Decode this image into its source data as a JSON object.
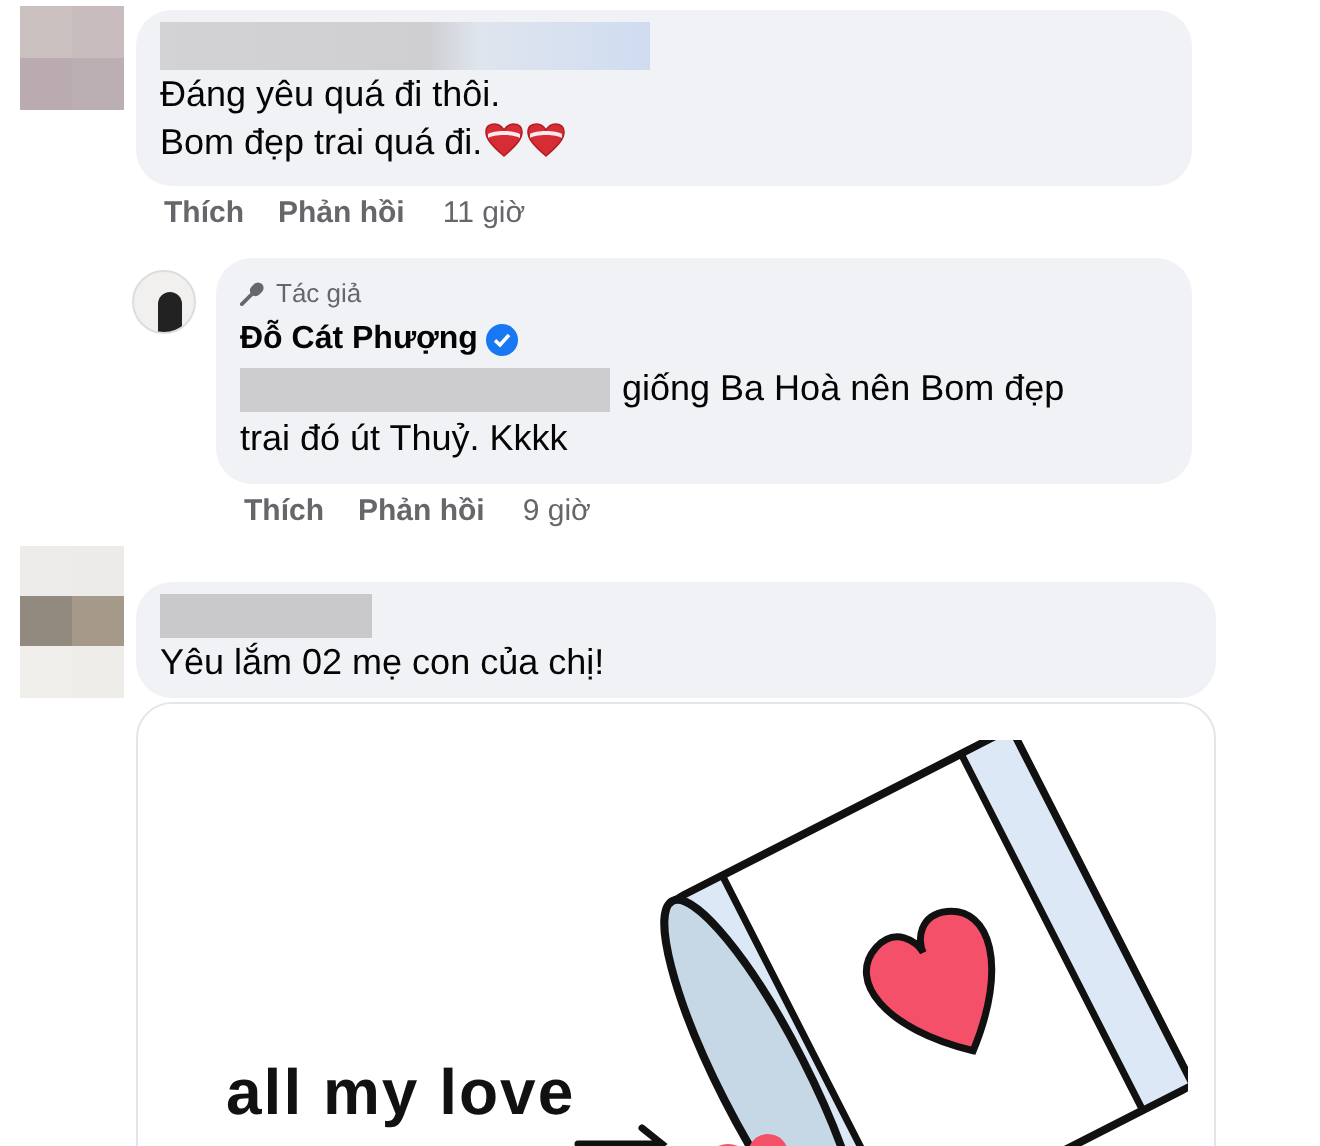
{
  "comments": [
    {
      "lines": [
        "Đáng yêu quá đi thôi.",
        "Bom đẹp trai quá đi."
      ],
      "hearts": true,
      "actions": [
        "Thích",
        "Phản hồi"
      ],
      "time": "11 giờ",
      "replies": [
        {
          "badge": "Tác giả",
          "author": "Đỗ Cát Phượng",
          "verified": true,
          "lines": [
            "giống Ba Hoà nên Bom đẹp",
            "trai đó út Thuỷ. Kkkk"
          ],
          "actions": [
            "Thích",
            "Phản hồi"
          ],
          "time": "9 giờ"
        }
      ]
    },
    {
      "lines": [
        "Yêu lắm 02 mẹ con của chị!"
      ],
      "hearts": false,
      "sticker": {
        "caption": "all my love"
      }
    }
  ]
}
